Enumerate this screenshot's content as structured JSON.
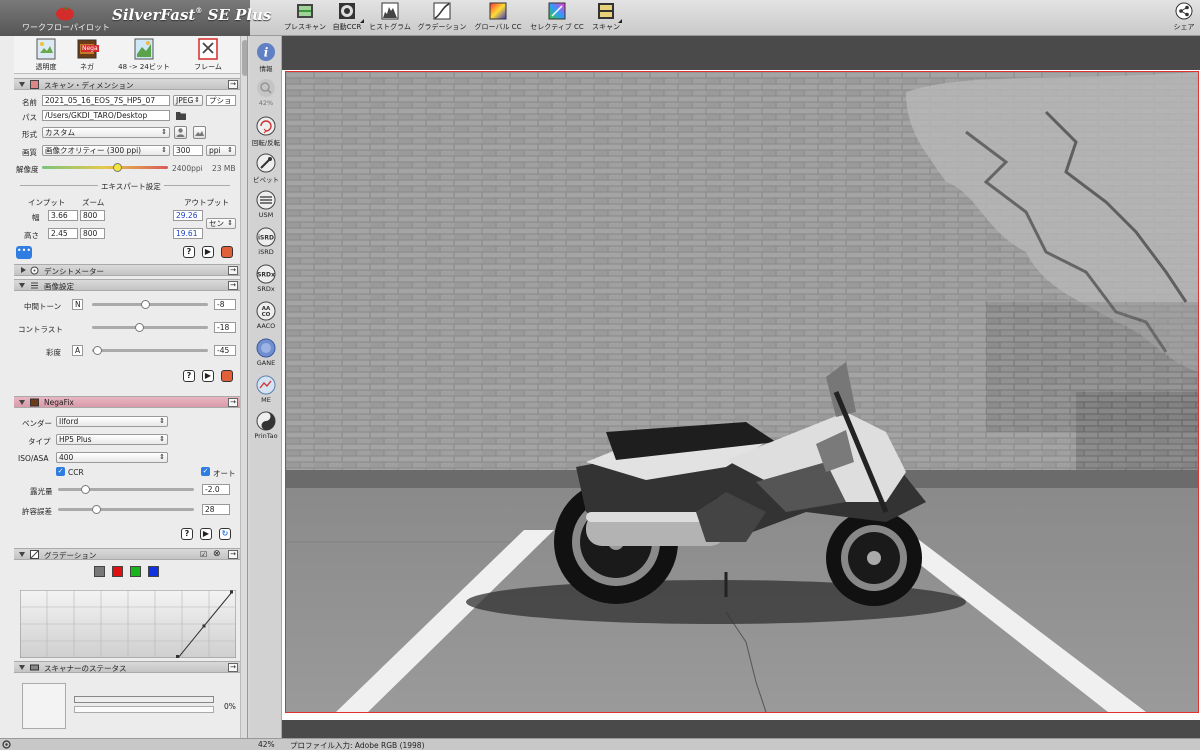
{
  "app": {
    "workflow_title": "ワークフローパイロット",
    "title": "SilverFast",
    "title_suffix": "SE Plus",
    "brand_color": "#d42b2b"
  },
  "toolbar": {
    "items": [
      {
        "label": "プレスキャン",
        "icon": "prescan-icon"
      },
      {
        "label": "自動CCR",
        "icon": "auto-ccr-icon"
      },
      {
        "label": "ヒストグラム",
        "icon": "histogram-icon"
      },
      {
        "label": "グラデーション",
        "icon": "gradation-icon"
      },
      {
        "label": "グローバル CC",
        "icon": "global-cc-icon"
      },
      {
        "label": "セレクティブ CC",
        "icon": "selective-cc-icon"
      },
      {
        "label": "スキャン",
        "icon": "scan-icon"
      }
    ],
    "share_label": "シェア"
  },
  "workflow": {
    "items": [
      {
        "label": "透明度",
        "icon": "transparency-icon"
      },
      {
        "label": "ネガ",
        "icon": "negative-icon"
      },
      {
        "label": "48 -> 24ビット",
        "icon": "bitdepth-icon"
      },
      {
        "label": "フレーム",
        "icon": "frame-icon"
      }
    ],
    "nega_badge": "Nega"
  },
  "scan_dim": {
    "header": "スキャン・ディメンション",
    "name_label": "名前",
    "name_value": "2021_05_16_EOS_7S_HP5_07",
    "format_value": "JPEG",
    "option_value": "プショ",
    "path_label": "パス",
    "path_value": "/Users/GKDI_TARO/Desktop",
    "type_label": "形式",
    "type_value": "カスタム",
    "quality_label": "画質",
    "quality_value": "画像クオリティー (300 ppi)",
    "ppi_value": "300",
    "ppi_unit": "ppi",
    "resolution_label": "解像度",
    "resolution_value": "2400ppi",
    "resolution_level": 0.6,
    "size_value": "23 MB",
    "expert_label": "エキスパート設定",
    "input_label": "インプット",
    "zoom_label": "ズーム",
    "output_label": "アウトプット",
    "width_label": "幅",
    "width_in": "3.66",
    "width_zoom": "800",
    "width_out": "29.26",
    "height_label": "高さ",
    "height_in": "2.45",
    "height_zoom": "800",
    "height_out": "19.61",
    "unit_value": "セン"
  },
  "densitometer": {
    "header": "デンシトメーター"
  },
  "image_settings": {
    "header": "画像設定",
    "midtone_label": "中間トーン",
    "midtone_mode": "N",
    "midtone_value": "-8",
    "midtone_level": 0.46,
    "contrast_label": "コントラスト",
    "contrast_value": "-18",
    "contrast_level": 0.41,
    "saturation_label": "彩度",
    "saturation_mode": "A",
    "saturation_value": "-45",
    "saturation_level": 0.05
  },
  "negafix": {
    "header": "NegaFix",
    "vendor_label": "ベンダー",
    "vendor_value": "Ilford",
    "type_label": "タイプ",
    "type_value": "HP5 Plus",
    "iso_label": "ISO/ASA",
    "iso_value": "400",
    "ccr_label": "CCR",
    "auto_label": "オート",
    "exposure_label": "露光量",
    "exposure_value": "-2.0",
    "exposure_level": 0.2,
    "tolerance_label": "許容誤差",
    "tolerance_value": "28",
    "tolerance_level": 0.28
  },
  "gradation": {
    "header": "グラデーション",
    "channels": [
      "#777777",
      "#e01010",
      "#1bb31b",
      "#1032e0"
    ]
  },
  "scanner_status": {
    "header": "スキャナーのステータス",
    "progress": "0%",
    "progress_level": 0
  },
  "vtools": [
    {
      "label": "情報",
      "icon": "info-icon"
    },
    {
      "label": "42%",
      "icon": "zoom-icon"
    },
    {
      "label": "回転/反転",
      "icon": "rotate-icon"
    },
    {
      "label": "ピペット",
      "icon": "pipette-icon"
    },
    {
      "label": "USM",
      "icon": "usm-icon"
    },
    {
      "label": "iSRD",
      "icon": "isrd-icon"
    },
    {
      "label": "SRDx",
      "icon": "srdx-icon"
    },
    {
      "label": "AACO",
      "icon": "aaco-icon"
    },
    {
      "label": "GANE",
      "icon": "gane-icon"
    },
    {
      "label": "ME",
      "icon": "me-icon"
    },
    {
      "label": "PrinTao",
      "icon": "printao-icon"
    }
  ],
  "status": {
    "zoom": "42%",
    "profile": "プロファイル入力: Adobe RGB (1998)"
  }
}
